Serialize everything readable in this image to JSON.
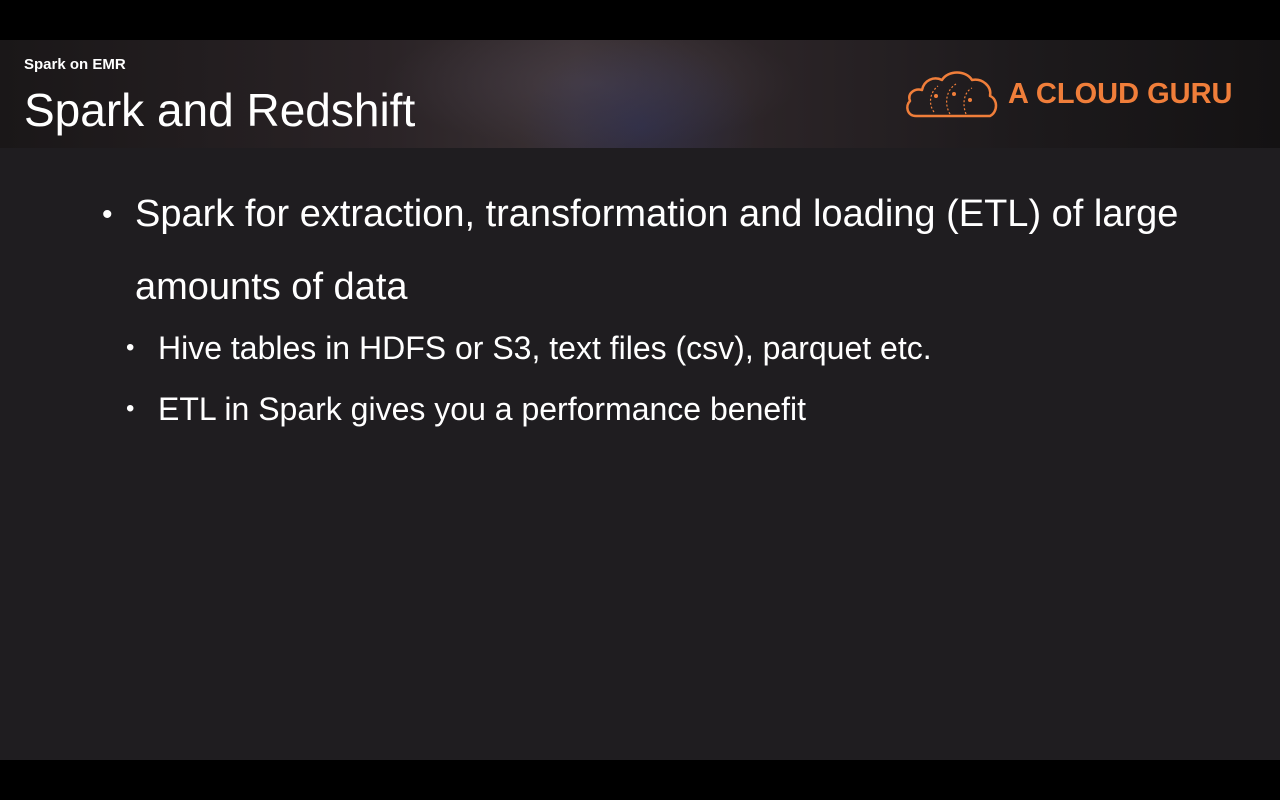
{
  "header": {
    "subtitle": "Spark on EMR",
    "title": "Spark and Redshift",
    "logo_text": "A CLOUD GURU",
    "logo_icon": "cloud-icon",
    "accent_color": "#f07e3a"
  },
  "content": {
    "bullet_symbol": "•",
    "sub_bullet_symbol": "•",
    "main_bullet": "Spark for extraction, transformation and loading (ETL) of large amounts of data",
    "sub_bullets": [
      "Hive tables in HDFS or S3, text files (csv), parquet etc.",
      "ETL in Spark gives you a performance benefit"
    ]
  }
}
